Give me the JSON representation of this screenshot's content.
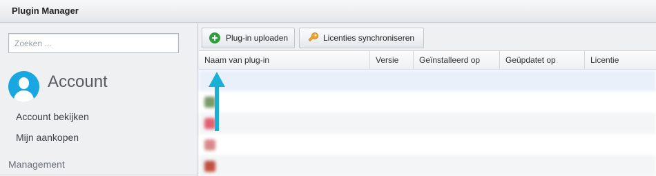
{
  "window": {
    "title": "Plugin Manager"
  },
  "sidebar": {
    "search": {
      "placeholder": "Zoeken ...",
      "value": ""
    },
    "account": {
      "title": "Account"
    },
    "items": [
      {
        "label": "Account bekijken"
      },
      {
        "label": "Mijn aankopen"
      }
    ],
    "section_heading": "Management"
  },
  "toolbar": {
    "upload_label": "Plug-in uploaden",
    "sync_label": "Licenties synchroniseren"
  },
  "table": {
    "columns": [
      "Naam van plug-in",
      "Versie",
      "Geïnstalleerd op",
      "Geüpdatet op",
      "Licentie"
    ]
  },
  "colors": {
    "accent": "#1aa6e0",
    "arrow": "#1ab0d6",
    "upload_icon": "#2e9e3e",
    "key_icon": "#f0a830"
  },
  "icons": {
    "upload": "plus-circle-icon",
    "sync": "key-icon",
    "avatar": "user-avatar-icon",
    "pointer": "arrow-up-icon"
  }
}
